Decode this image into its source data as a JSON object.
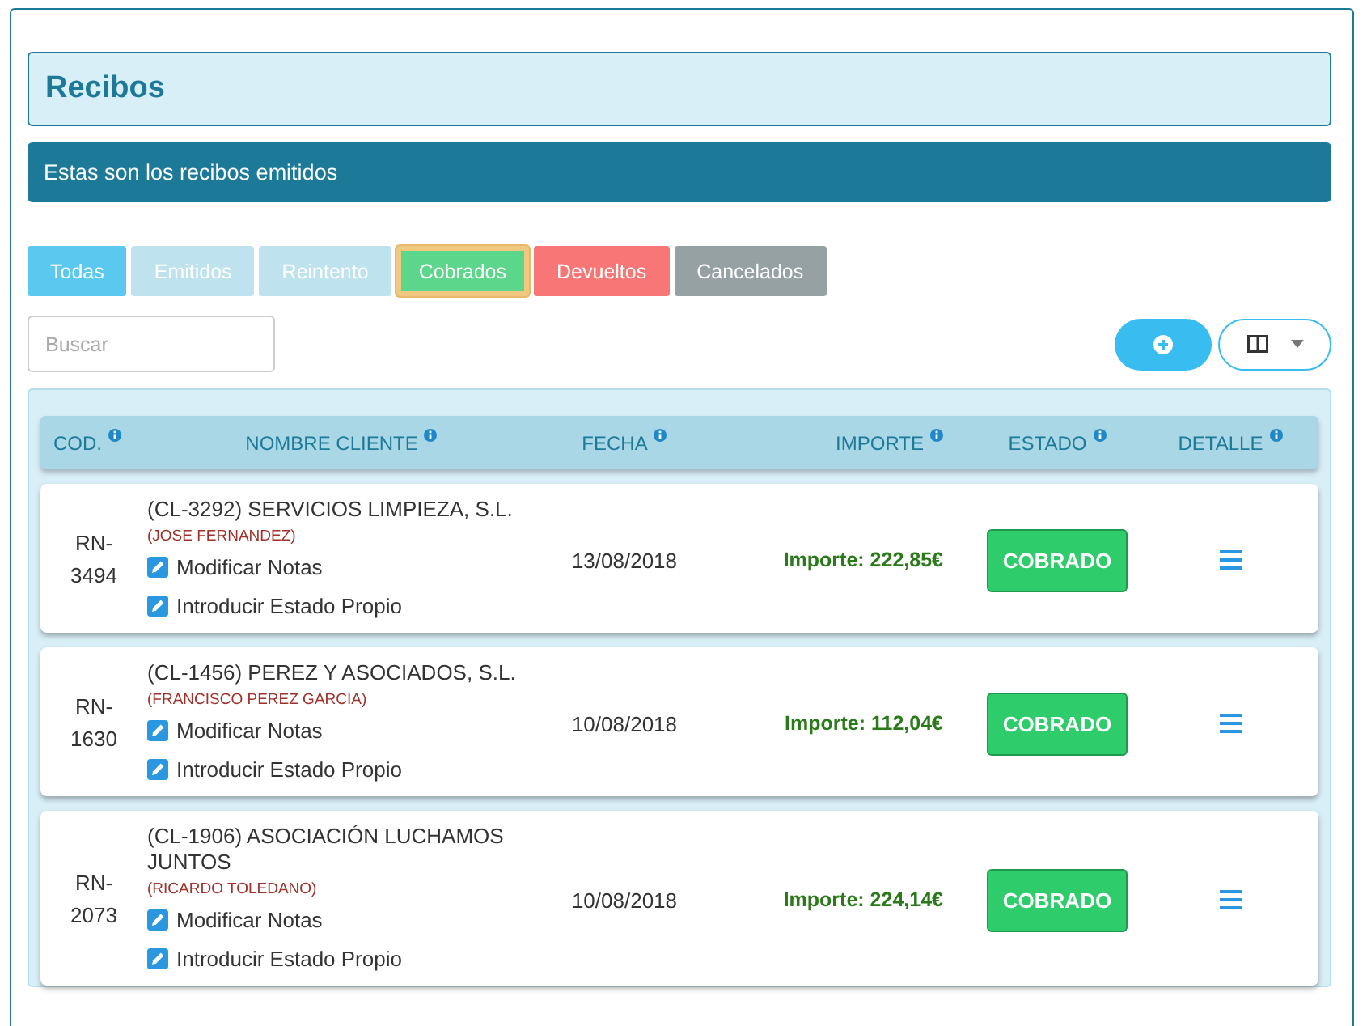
{
  "title": "Recibos",
  "banner": "Estas son los recibos emitidos",
  "filters": [
    {
      "label": "Todas",
      "color": "#5bc8ef",
      "selected": false
    },
    {
      "label": "Emitidos",
      "color": "#bfe3ee",
      "selected": false
    },
    {
      "label": "Reintento",
      "color": "#bfe3ee",
      "selected": false
    },
    {
      "label": "Cobrados",
      "color": "#5cd68a",
      "selected": true
    },
    {
      "label": "Devueltos",
      "color": "#f87676",
      "selected": false
    },
    {
      "label": "Cancelados",
      "color": "#96a1a4",
      "selected": false
    }
  ],
  "search": {
    "placeholder": "Buscar"
  },
  "table": {
    "columns": [
      "COD.",
      "NOMBRE CLIENTE",
      "FECHA",
      "IMPORTE",
      "ESTADO",
      "DETALLE"
    ],
    "rows": [
      {
        "code": "RN-3494",
        "client": "(CL-3292) SERVICIOS LIMPIEZA, S.L.",
        "contact": "(JOSE FERNANDEZ)",
        "actions": [
          "Modificar Notas",
          "Introducir Estado Propio"
        ],
        "date": "13/08/2018",
        "amount": "Importe: 222,85€",
        "status": "COBRADO"
      },
      {
        "code": "RN-1630",
        "client": "(CL-1456) PEREZ Y ASOCIADOS, S.L.",
        "contact": "(FRANCISCO PEREZ GARCIA)",
        "actions": [
          "Modificar Notas",
          "Introducir Estado Propio"
        ],
        "date": "10/08/2018",
        "amount": "Importe: 112,04€",
        "status": "COBRADO"
      },
      {
        "code": "RN-2073",
        "client": "(CL-1906) ASOCIACIÓN LUCHAMOS JUNTOS",
        "contact": "(RICARDO TOLEDANO)",
        "actions": [
          "Modificar Notas",
          "Introducir Estado Propio"
        ],
        "date": "10/08/2018",
        "amount": "Importe: 224,14€",
        "status": "COBRADO"
      }
    ]
  }
}
